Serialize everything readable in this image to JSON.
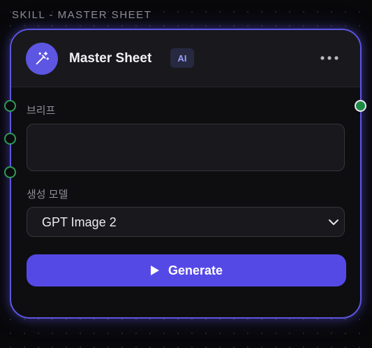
{
  "node": {
    "caption": "SKILL - MASTER SHEET",
    "title": "Master Sheet",
    "badge": "AI",
    "icon": "magic-wand-icon",
    "menu_icon": "more-horizontal-icon"
  },
  "fields": {
    "brief": {
      "label": "브리프",
      "value": "",
      "placeholder": ""
    },
    "model": {
      "label": "생성 모델",
      "selected": "GPT Image 2"
    }
  },
  "actions": {
    "generate": {
      "label": "Generate",
      "icon": "play-icon"
    }
  },
  "ports": {
    "inputs": [
      "input-port",
      "input-port",
      "input-port"
    ],
    "outputs": [
      "output-port"
    ]
  },
  "colors": {
    "accent": "#5d56e2",
    "button": "#5549e6",
    "port_input": "#2f9a55",
    "port_output": "#1d8a45",
    "badge_text": "#9b9ef7",
    "canvas": "#08080a",
    "card": "#0e0e11"
  }
}
